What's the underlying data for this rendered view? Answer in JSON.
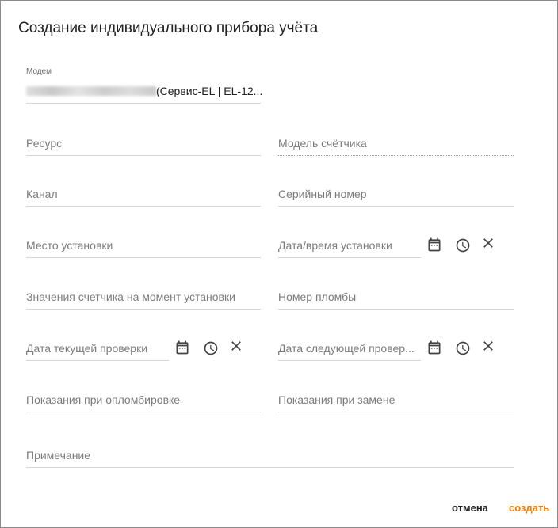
{
  "dialog": {
    "title": "Создание индивидуального прибора учёта"
  },
  "modem": {
    "caption": "Модем",
    "value": "(Сервис-EL | EL-12..."
  },
  "fields": {
    "resource": "Ресурс",
    "meter_model": "Модель счётчика",
    "channel": "Канал",
    "serial_number": "Серийный номер",
    "install_place": "Место установки",
    "install_datetime": "Дата/время установки",
    "install_reading": "Значения счетчика на момент установки",
    "seal_number": "Номер пломбы",
    "current_check_date": "Дата текущей проверки",
    "next_check_date": "Дата следующей провер...",
    "seal_reading": "Показания при опломбировке",
    "replace_reading": "Показания при замене",
    "note": "Примечание"
  },
  "icons": {
    "calendar": "calendar-icon",
    "clock": "clock-icon",
    "clear": "close-icon"
  },
  "actions": {
    "cancel_label": "отмена",
    "create_label": "создать"
  },
  "colors": {
    "accent": "#f57c00",
    "label": "#7b7b7b",
    "icon": "#424242"
  }
}
